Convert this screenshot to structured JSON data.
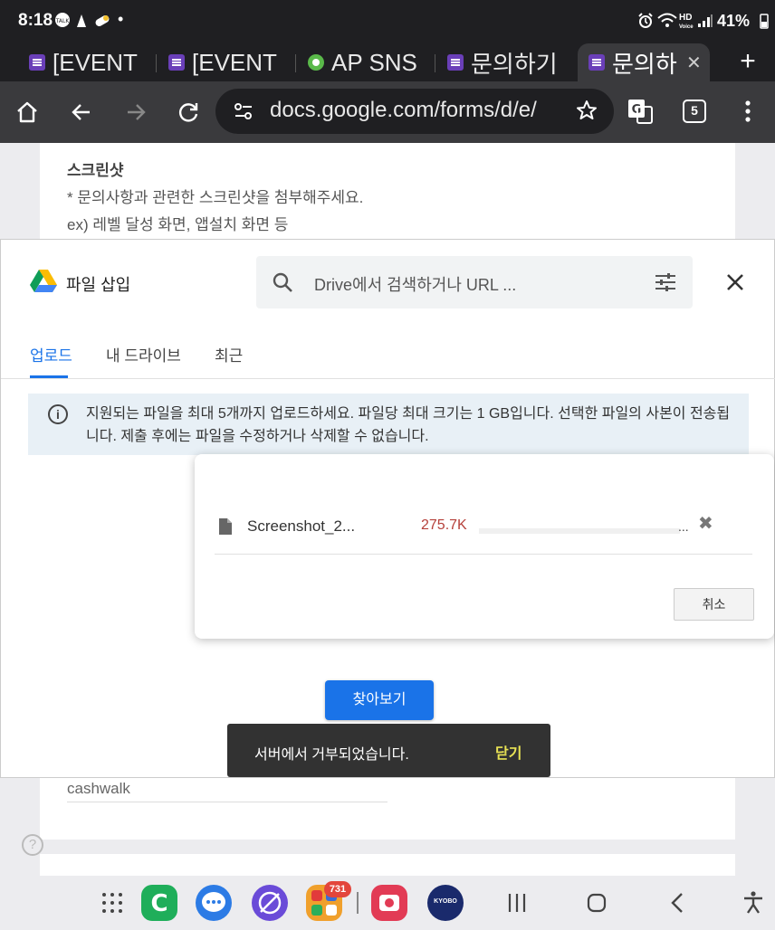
{
  "status_bar": {
    "time": "8:18",
    "hd_label": "HD",
    "voice_label": "Voice",
    "battery": "41%"
  },
  "tabs": [
    {
      "label": "[EVENT"
    },
    {
      "label": "[EVENT"
    },
    {
      "label": "AP SNS"
    },
    {
      "label": "문의하기"
    },
    {
      "label": "문의하"
    }
  ],
  "tab_count": "5",
  "omnibox": {
    "url": "docs.google.com/forms/d/e/"
  },
  "form": {
    "question_title": "스크린샷",
    "question_desc_1": "* 문의사항과 관련한 스크린샷을 첨부해주세요.",
    "question_desc_2": "ex) 레벨 달성 화면, 앱설치 화면 등",
    "answer_value": "cashwalk"
  },
  "picker": {
    "title": "파일 삽입",
    "search_placeholder": "Drive에서 검색하거나 URL ...",
    "tabs": {
      "upload": "업로드",
      "my_drive": "내 드라이브",
      "recent": "최근"
    },
    "info_text": "지원되는 파일을 최대 5개까지 업로드하세요. 파일당 최대 크기는 1 GB입니다. 선택한 파일의 사본이 전송됩니다. 제출 후에는 파일을 수정하거나 삭제할 수 없습니다.",
    "browse_label": "찾아보기"
  },
  "upload": {
    "file_name": "Screenshot_2...",
    "file_size": "275.7K",
    "ellipsis": "...",
    "cancel_label": "취소"
  },
  "snackbar": {
    "message": "서버에서 거부되었습니다.",
    "close_label": "닫기"
  },
  "nav": {
    "badge": "731",
    "kyobo_label": "KYOBO"
  }
}
